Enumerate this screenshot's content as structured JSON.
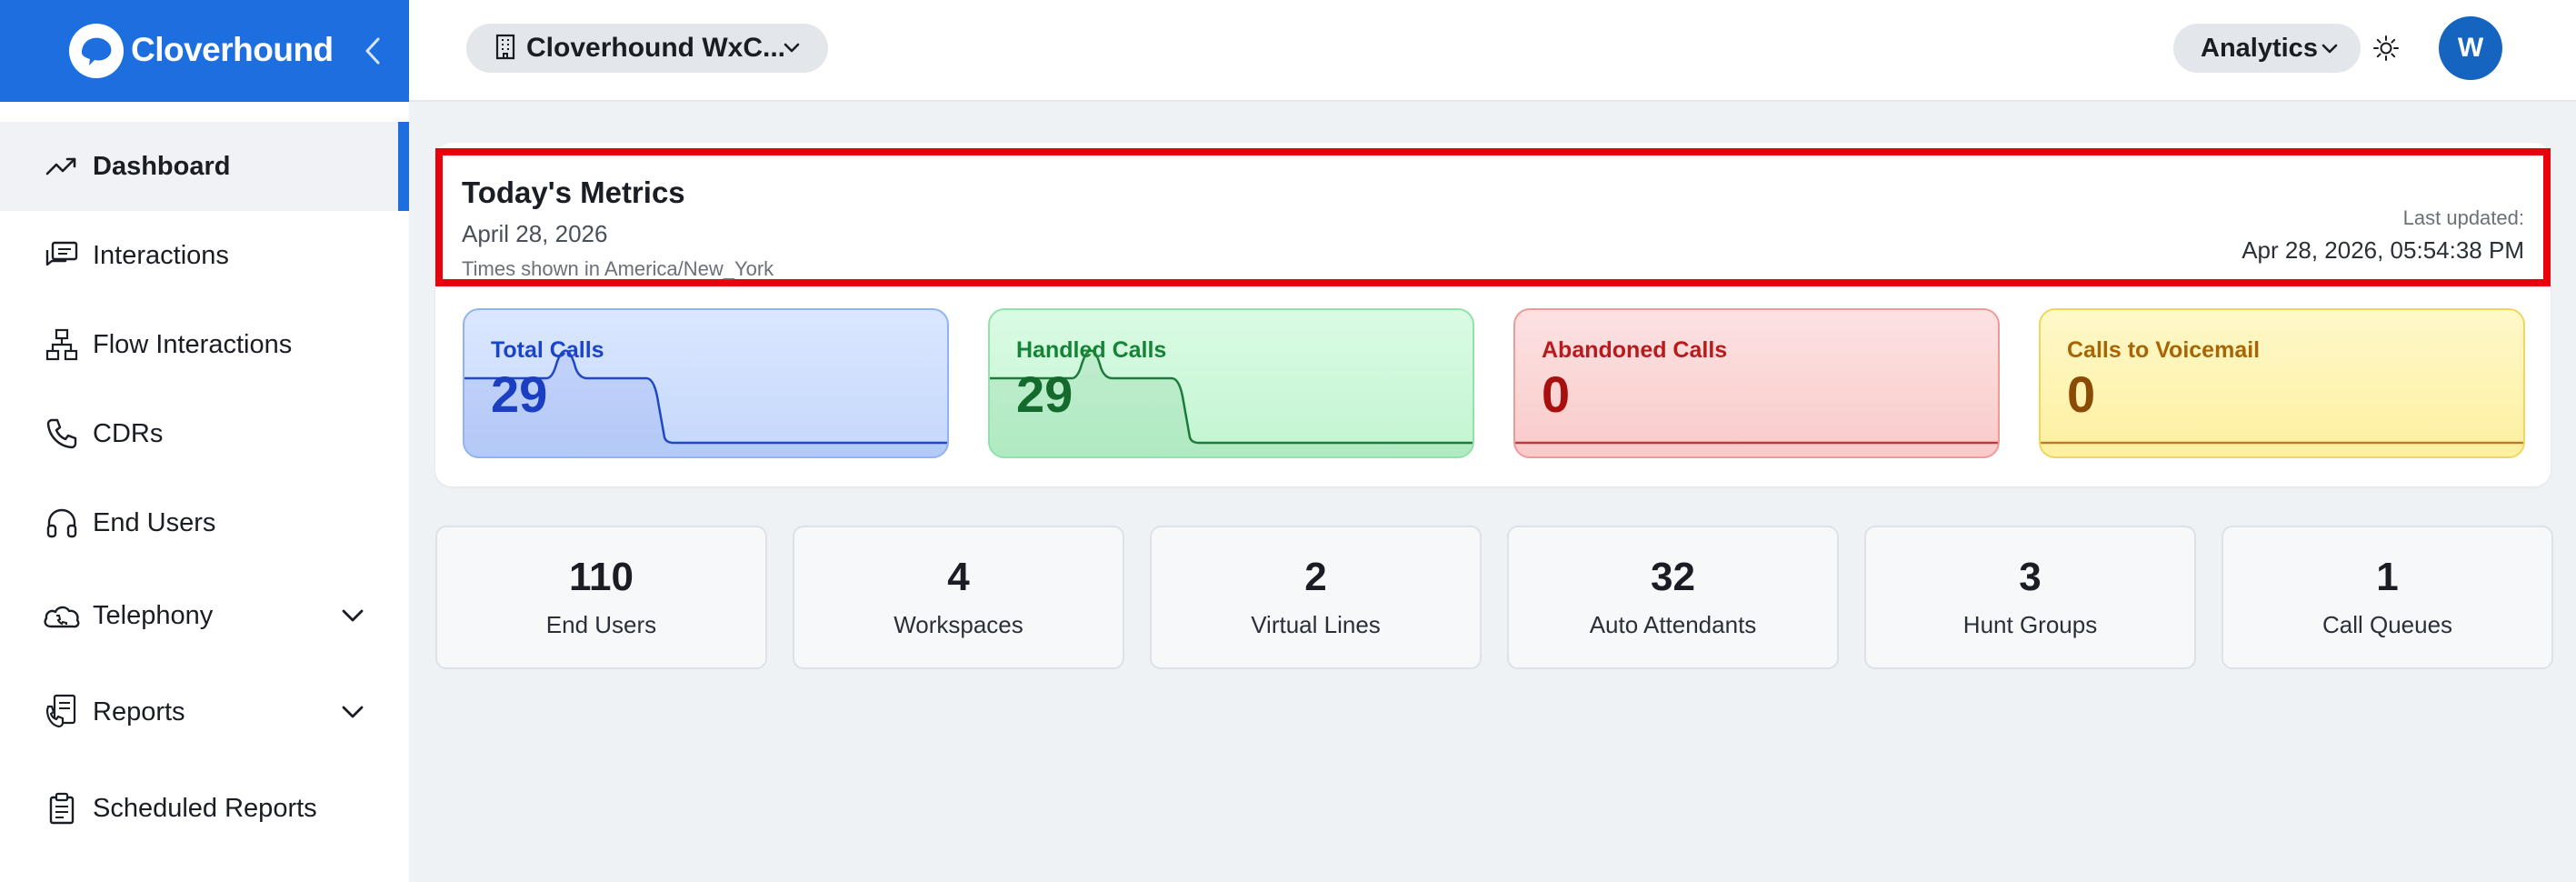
{
  "app": {
    "brand": "Cloverhound"
  },
  "sidebar": {
    "items": [
      {
        "label": "Dashboard",
        "icon": "trending-up-icon",
        "active": true
      },
      {
        "label": "Interactions",
        "icon": "chat-bubbles-icon"
      },
      {
        "label": "Flow Interactions",
        "icon": "flow-tree-icon"
      },
      {
        "label": "CDRs",
        "icon": "phone-icon"
      },
      {
        "label": "End Users",
        "icon": "headset-icon"
      },
      {
        "label": "Telephony",
        "icon": "phone-cloud-icon",
        "expandable": true
      },
      {
        "label": "Reports",
        "icon": "phone-report-icon",
        "expandable": true
      },
      {
        "label": "Scheduled Reports",
        "icon": "clipboard-icon"
      }
    ]
  },
  "topbar": {
    "org_name": "Cloverhound WxC...",
    "analytics_label": "Analytics",
    "avatar_initial": "W"
  },
  "metrics": {
    "title": "Today's Metrics",
    "date": "April 28, 2026",
    "timezone_note": "Times shown in America/New_York",
    "last_updated_label": "Last updated:",
    "last_updated_value": "Apr 28, 2026, 05:54:38 PM",
    "cards": [
      {
        "label": "Total Calls",
        "value": "29",
        "color": "#1b45c9"
      },
      {
        "label": "Handled Calls",
        "value": "29",
        "color": "#178336"
      },
      {
        "label": "Abandoned Calls",
        "value": "0",
        "color": "#b81b1b"
      },
      {
        "label": "Calls to Voicemail",
        "value": "0",
        "color": "#a86505"
      }
    ]
  },
  "summary": [
    {
      "value": "110",
      "label": "End Users"
    },
    {
      "value": "4",
      "label": "Workspaces"
    },
    {
      "value": "2",
      "label": "Virtual Lines"
    },
    {
      "value": "32",
      "label": "Auto Attendants"
    },
    {
      "value": "3",
      "label": "Hunt Groups"
    },
    {
      "value": "1",
      "label": "Call Queues"
    }
  ],
  "colors": {
    "accent": "#1d6fe0",
    "highlight_border": "#e8000a"
  }
}
